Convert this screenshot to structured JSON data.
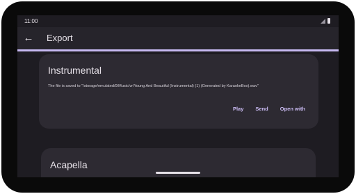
{
  "status_bar": {
    "time": "11:00"
  },
  "app_bar": {
    "back_icon": "arrow-back-icon",
    "back_glyph": "←",
    "title": "Export"
  },
  "progress": {
    "fraction": 1.0,
    "color": "#c7b9f2"
  },
  "cards": [
    {
      "title": "Instrumental",
      "message": "The file is saved to \"/storage/emulated/0/Music/vr/Young And Beautiful (Instrumental) (1) (Generated by KaraokeBox).wav\"",
      "actions": [
        "Play",
        "Send",
        "Open with"
      ]
    },
    {
      "title": "Acapella"
    }
  ],
  "colors": {
    "background": "#1e1c22",
    "card": "#2d2a32",
    "accent": "#cbbcf4",
    "text": "#e6e1e8"
  }
}
